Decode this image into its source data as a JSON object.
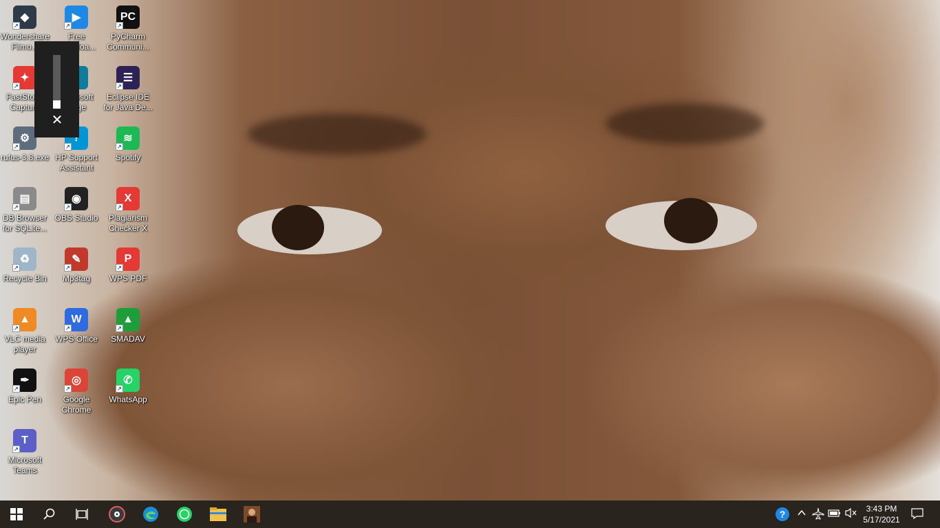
{
  "desktop": {
    "icons": [
      {
        "label": "Wondershare Filmo...",
        "icon": "filmora-icon",
        "color": "#2d3a4a",
        "glyph": "◆"
      },
      {
        "label": "Free Downloa...",
        "icon": "free-download-icon",
        "color": "#1e88e5",
        "glyph": "▶"
      },
      {
        "label": "PyCharm Communi...",
        "icon": "pycharm-icon",
        "color": "#111111",
        "glyph": "PC"
      },
      {
        "label": "FastStone Capture",
        "icon": "faststone-icon",
        "color": "#e53935",
        "glyph": "✦"
      },
      {
        "label": "Microsoft Edge",
        "icon": "edge-icon",
        "color": "#0f7c9c",
        "glyph": "e"
      },
      {
        "label": "Eclipse IDE for Java De...",
        "icon": "eclipse-icon",
        "color": "#2c2255",
        "glyph": "☰"
      },
      {
        "label": "rufus-3.8.exe",
        "icon": "rufus-icon",
        "color": "#5d6d7e",
        "glyph": "⚙"
      },
      {
        "label": "HP Support Assistant",
        "icon": "hp-support-icon",
        "color": "#0096d6",
        "glyph": "?"
      },
      {
        "label": "Spotify",
        "icon": "spotify-icon",
        "color": "#1db954",
        "glyph": "≋"
      },
      {
        "label": "DB Browser for SQLite...",
        "icon": "db-browser-icon",
        "color": "#8a8a8a",
        "glyph": "▤"
      },
      {
        "label": "OBS Studio",
        "icon": "obs-icon",
        "color": "#222222",
        "glyph": "◉"
      },
      {
        "label": "Plagiarism Checker X",
        "icon": "plagiarism-checker-icon",
        "color": "#e53935",
        "glyph": "X"
      },
      {
        "label": "Recycle Bin",
        "icon": "recycle-bin-icon",
        "color": "#9fb6c9",
        "glyph": "♻"
      },
      {
        "label": "Mp3tag",
        "icon": "mp3tag-icon",
        "color": "#c0392b",
        "glyph": "✎"
      },
      {
        "label": "WPS PDF",
        "icon": "wps-pdf-icon",
        "color": "#e53935",
        "glyph": "P"
      },
      {
        "label": "VLC media player",
        "icon": "vlc-icon",
        "color": "#f08a24",
        "glyph": "▲"
      },
      {
        "label": "WPS Office",
        "icon": "wps-office-icon",
        "color": "#2f6be0",
        "glyph": "W"
      },
      {
        "label": "SMADAV",
        "icon": "smadav-icon",
        "color": "#1e9e3a",
        "glyph": "▲"
      },
      {
        "label": "Epic Pen",
        "icon": "epic-pen-icon",
        "color": "#111111",
        "glyph": "✒"
      },
      {
        "label": "Google Chrome",
        "icon": "chrome-icon",
        "color": "#db4437",
        "glyph": "◎"
      },
      {
        "label": "WhatsApp",
        "icon": "whatsapp-icon",
        "color": "#25d366",
        "glyph": "✆"
      },
      {
        "label": "Microsoft Teams",
        "icon": "teams-icon",
        "color": "#5b5fc7",
        "glyph": "T"
      }
    ]
  },
  "volume_flyout": {
    "level": 0.15,
    "close_glyph": "✕"
  },
  "taskbar": {
    "pinned": [
      {
        "icon": "windows-start-icon",
        "glyph": "⊞"
      },
      {
        "icon": "search-icon",
        "glyph": "⌕"
      },
      {
        "icon": "task-view-icon",
        "glyph": "❐"
      },
      {
        "icon": "media-player-icon",
        "glyph": "◉"
      },
      {
        "icon": "edge-icon",
        "glyph": "e"
      },
      {
        "icon": "whatsapp-icon",
        "glyph": "✆"
      },
      {
        "icon": "file-explorer-icon",
        "glyph": "▬"
      },
      {
        "icon": "photo-app-icon",
        "glyph": "▣"
      }
    ],
    "tray": [
      {
        "icon": "help-icon",
        "glyph": "?"
      },
      {
        "icon": "chevron-up-icon",
        "glyph": "^"
      },
      {
        "icon": "airplane-mode-icon",
        "glyph": "✈"
      },
      {
        "icon": "battery-icon",
        "glyph": "▭"
      },
      {
        "icon": "volume-muted-icon",
        "glyph": "🔈"
      }
    ],
    "clock": {
      "time": "3:43 PM",
      "date": "5/17/2021"
    },
    "notification_icon": "notification-icon"
  }
}
